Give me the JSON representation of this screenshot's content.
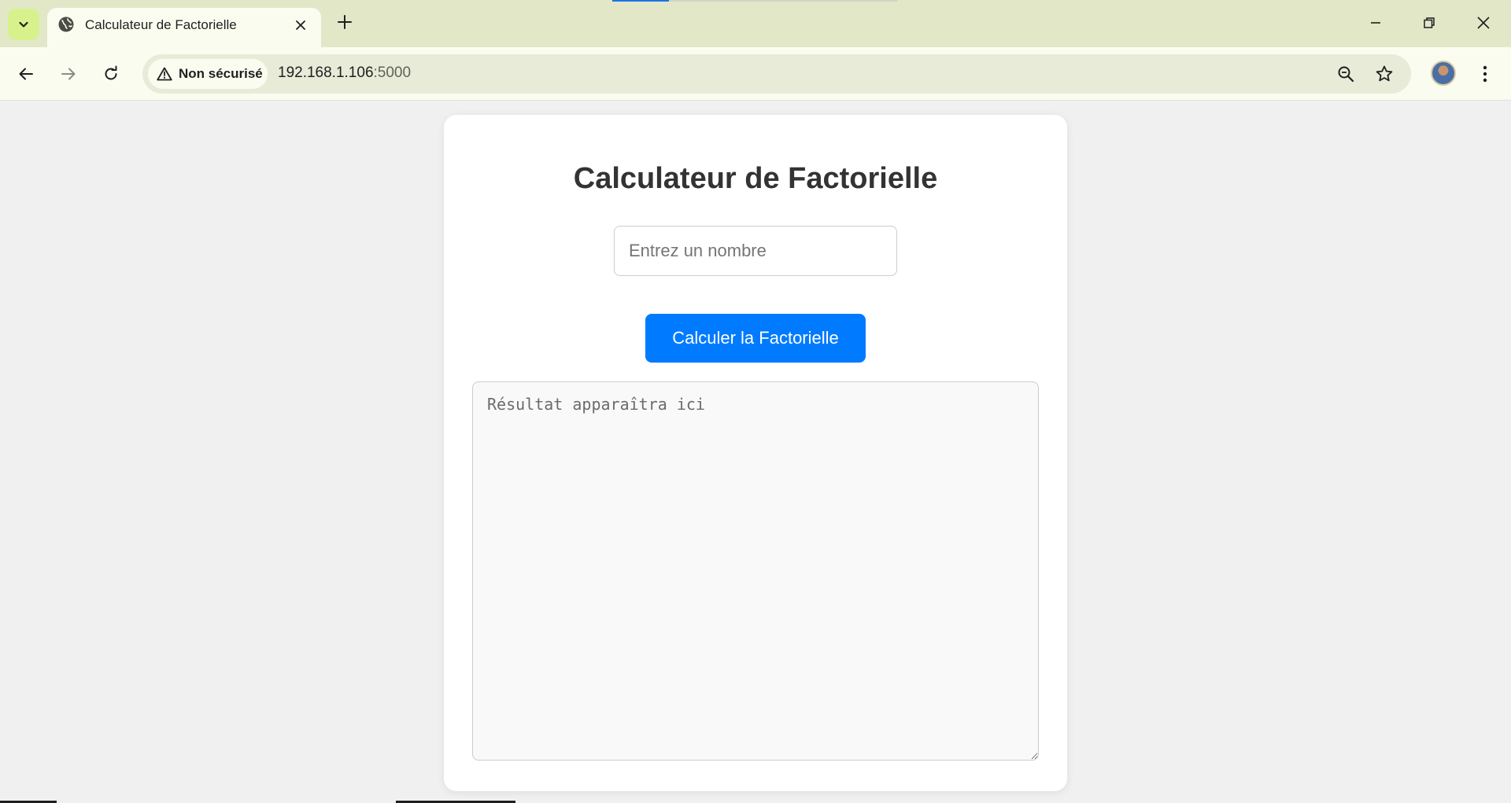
{
  "browser": {
    "tab": {
      "title": "Calculateur de Factorielle"
    },
    "security_chip": "Non sécurisé",
    "url": {
      "host": "192.168.1.106",
      "port": ":5000"
    },
    "icons": {
      "tab_search": "chevron-down-icon",
      "favicon": "globe-icon",
      "tab_close": "close-icon",
      "new_tab": "plus-icon",
      "minimize": "minimize-icon",
      "restore": "restore-icon",
      "close_window": "close-icon",
      "back": "arrow-left-icon",
      "forward": "arrow-right-icon",
      "reload": "reload-icon",
      "warning": "warning-icon",
      "zoom": "zoom-out-icon",
      "bookmark": "star-icon",
      "menu": "kebab-menu-icon"
    },
    "colors": {
      "tabstrip": "#e2e7c8",
      "toolbar": "#fbfcf0",
      "omnibox": "#e8ebd8"
    }
  },
  "page": {
    "title": "Calculateur de Factorielle",
    "number_input": {
      "placeholder": "Entrez un nombre",
      "value": ""
    },
    "calculate_button": "Calculer la Factorielle",
    "result_area": {
      "placeholder": "Résultat apparaîtra ici",
      "value": ""
    },
    "colors": {
      "accent": "#007bff",
      "background": "#f0f0f0",
      "card": "#ffffff"
    }
  }
}
